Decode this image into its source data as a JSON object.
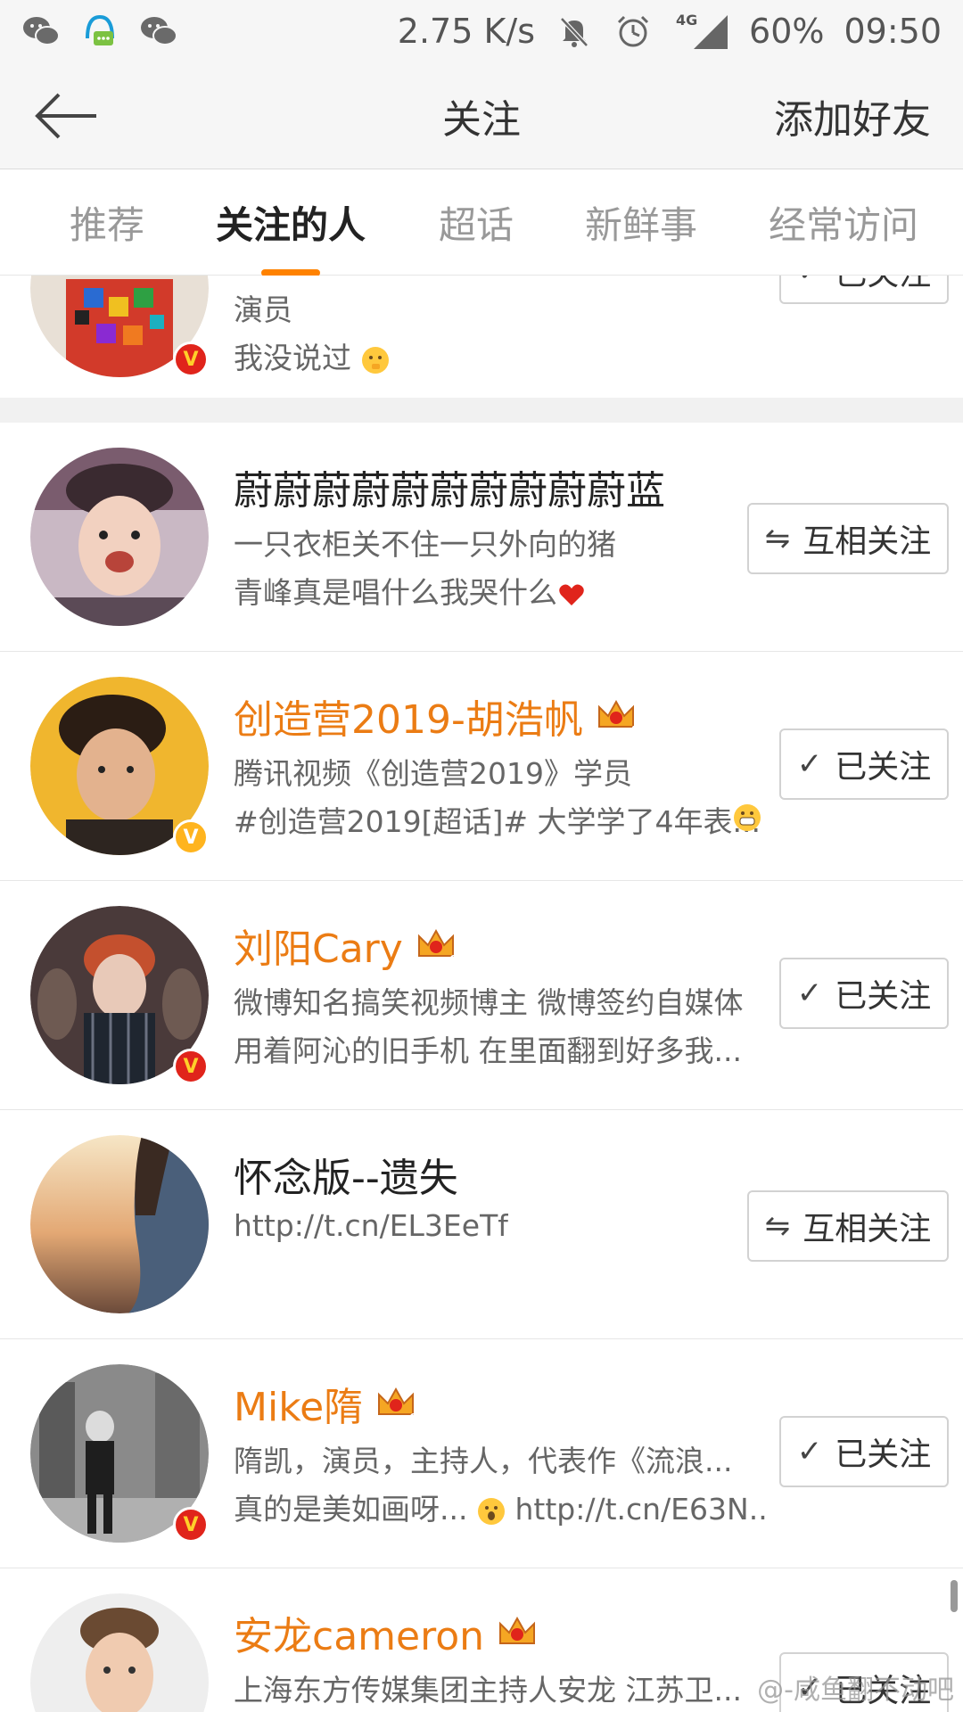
{
  "status_bar": {
    "left_icons": [
      "wechat-icon",
      "qq-icon",
      "wechat-icon"
    ],
    "network_speed": "2.75 K/s",
    "network_type": "4G",
    "battery": "60%",
    "time": "09:50"
  },
  "nav": {
    "title": "关注",
    "action": "添加好友"
  },
  "tabs": [
    {
      "label": "推荐",
      "active": false
    },
    {
      "label": "关注的人",
      "active": true
    },
    {
      "label": "超话",
      "active": false
    },
    {
      "label": "新鲜事",
      "active": false
    },
    {
      "label": "经常访问",
      "active": false
    }
  ],
  "users": [
    {
      "name": "",
      "desc1": "演员",
      "desc2": "我没说过",
      "button": "已关注",
      "badge": "red"
    },
    {
      "name": "蔚蔚蔚蔚蔚蔚蔚蔚蔚蔚蓝",
      "desc1": "一只衣柜关不住一只外向的猪",
      "desc2": "青峰真是唱什么我哭什么",
      "button": "互相关注",
      "badge": ""
    },
    {
      "name": "创造营2019-胡浩帆",
      "desc1": "腾讯视频《创造营2019》学员",
      "desc2": "#创造营2019[超话]# 大学学了4年表...",
      "button": "已关注",
      "badge": "gold",
      "vip_level": "4"
    },
    {
      "name": "刘阳Cary",
      "desc1": "微博知名搞笑视频博主 微博签约自媒体",
      "desc2": "用着阿沁的旧手机 在里面翻到好多我...",
      "button": "已关注",
      "badge": "red",
      "vip_level": "6"
    },
    {
      "name": "怀念版--遗失",
      "desc1": "http://t.cn/EL3EeTf",
      "desc2": "",
      "button": "互相关注",
      "badge": ""
    },
    {
      "name": "Mike隋",
      "desc1": "隋凯，演员，主持人，代表作《流浪...",
      "desc2": "真的是美如画呀...",
      "desc2_link": "http://t.cn/E63N...",
      "button": "已关注",
      "badge": "red",
      "vip_level": "6"
    },
    {
      "name": "安龙cameron",
      "desc1": "上海东方传媒集团主持人安龙  江苏卫...",
      "desc2": "",
      "button": "已关注",
      "badge": "",
      "vip_level": ""
    }
  ],
  "colors": {
    "accent": "#ff8200",
    "vip_name": "#eb7c14",
    "verified_red": "#e0241b",
    "verified_gold": "#ffb41e"
  },
  "watermark": "@-咸鱼翻不动吧"
}
